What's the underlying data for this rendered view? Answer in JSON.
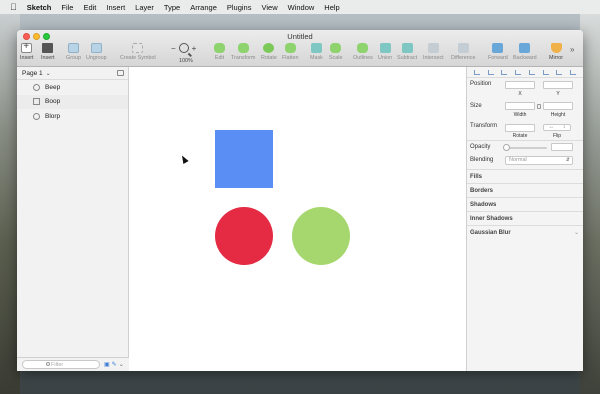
{
  "menubar": {
    "app_name": "Sketch",
    "items": [
      "File",
      "Edit",
      "Insert",
      "Layer",
      "Type",
      "Arrange",
      "Plugins",
      "View",
      "Window",
      "Help"
    ]
  },
  "window": {
    "title": "Untitled"
  },
  "toolbar": {
    "insert_label": "Insert",
    "insert2_label": "Insert",
    "group_label": "Group",
    "ungroup_label": "Ungroup",
    "create_symbol_label": "Create Symbol",
    "zoom_minus": "−",
    "zoom_plus": "+",
    "zoom_level": "100%",
    "edit_label": "Edit",
    "transform_label": "Transform",
    "rotate_label": "Rotate",
    "flatten_label": "Flatten",
    "mask_label": "Mask",
    "scale_label": "Scale",
    "outlines_label": "Outlines",
    "union_label": "Union",
    "subtract_label": "Subtract",
    "intersect_label": "Intersect",
    "difference_label": "Difference",
    "forward_label": "Forward",
    "backward_label": "Backward",
    "mirror_label": "Mirror",
    "more_label": "»"
  },
  "sidebar": {
    "page_name": "Page 1",
    "page_caret": "⌄",
    "layers": [
      {
        "name": "Beep",
        "icon": "circle-shape-icon"
      },
      {
        "name": "Boop",
        "icon": "rectangle-shape-icon"
      },
      {
        "name": "Blorp",
        "icon": "circle-shape-icon"
      }
    ],
    "filter_placeholder": "Filter"
  },
  "canvas": {
    "shapes": [
      {
        "name": "Boop",
        "type": "rectangle",
        "color": "#5b8ef5"
      },
      {
        "name": "Beep",
        "type": "circle",
        "color": "#e42b43"
      },
      {
        "name": "Blorp",
        "type": "circle",
        "color": "#a6d76f"
      }
    ]
  },
  "inspector": {
    "position_label": "Position",
    "x_label": "X",
    "y_label": "Y",
    "size_label": "Size",
    "width_label": "Width",
    "height_label": "Height",
    "transform_label": "Transform",
    "rotate_label": "Rotate",
    "flip_label": "Flip",
    "opacity_label": "Opacity",
    "blending_label": "Blending",
    "blending_value": "Normal",
    "sections": [
      "Fills",
      "Borders",
      "Shadows",
      "Inner Shadows",
      "Gaussian Blur"
    ]
  }
}
